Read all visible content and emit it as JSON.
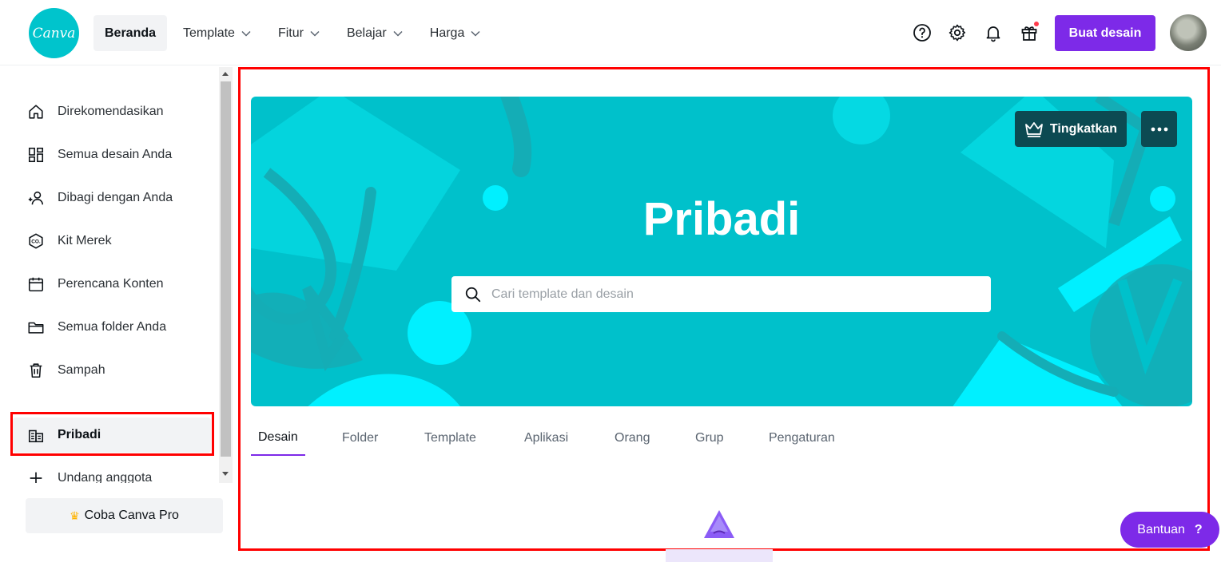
{
  "header": {
    "logo_text": "Canva",
    "nav": [
      {
        "label": "Beranda",
        "active": true,
        "dropdown": false
      },
      {
        "label": "Template",
        "active": false,
        "dropdown": true
      },
      {
        "label": "Fitur",
        "active": false,
        "dropdown": true
      },
      {
        "label": "Belajar",
        "active": false,
        "dropdown": true
      },
      {
        "label": "Harga",
        "active": false,
        "dropdown": true
      }
    ],
    "icons": [
      "help-icon",
      "settings-icon",
      "bell-icon",
      "gift-icon"
    ],
    "create_button": "Buat desain",
    "accent_color": "#7d2ae8"
  },
  "sidebar": {
    "items": [
      {
        "label": "Direkomendasikan",
        "icon": "home-icon"
      },
      {
        "label": "Semua desain Anda",
        "icon": "grid-icon"
      },
      {
        "label": "Dibagi dengan Anda",
        "icon": "users-icon"
      },
      {
        "label": "Kit Merek",
        "icon": "brand-kit-icon"
      },
      {
        "label": "Perencana Konten",
        "icon": "calendar-icon"
      },
      {
        "label": "Semua folder Anda",
        "icon": "folder-icon"
      },
      {
        "label": "Sampah",
        "icon": "trash-icon"
      },
      {
        "label": "Pribadi",
        "icon": "team-building-icon",
        "active": true
      },
      {
        "label": "Undang anggota",
        "icon": "plus-icon"
      }
    ],
    "pro_button": "Coba Canva Pro"
  },
  "hero": {
    "title": "Pribadi",
    "search_placeholder": "Cari template dan desain",
    "upgrade_button": "Tingkatkan",
    "background_color": "#00c1cb"
  },
  "tabs": [
    {
      "label": "Desain",
      "active": true
    },
    {
      "label": "Folder",
      "active": false
    },
    {
      "label": "Template",
      "active": false
    },
    {
      "label": "Aplikasi",
      "active": false
    },
    {
      "label": "Orang",
      "active": false
    },
    {
      "label": "Grup",
      "active": false
    },
    {
      "label": "Pengaturan",
      "active": false
    }
  ],
  "help_button": {
    "label": "Bantuan",
    "symbol": "?"
  }
}
